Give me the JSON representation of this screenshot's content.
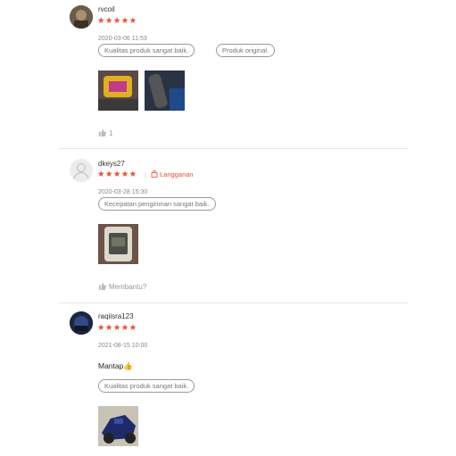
{
  "reviews": [
    {
      "username": "rvcoil",
      "stars": "★★★★★",
      "date": "2020-03-06 11:53",
      "tags": [
        "Kualitas produk sangat baik.",
        "Produk original."
      ],
      "helpful_text": "1"
    },
    {
      "username": "dkeys27",
      "stars": "★★★★★",
      "subscription_label": "Langganan",
      "date": "2020-03-28 15:30",
      "tags": [
        "Kecepatan pengiriman sangat baik."
      ],
      "helpful_text": "Membantu?"
    },
    {
      "username": "raqiisra123",
      "stars": "★★★★★",
      "date": "2021-08-15 10:00",
      "comment": "Mantap👍",
      "tags": [
        "Kualitas produk sangat baik."
      ]
    }
  ],
  "colors": {
    "accent": "#ee4d2d",
    "muted": "#999999",
    "divider": "#e8e8e8"
  }
}
